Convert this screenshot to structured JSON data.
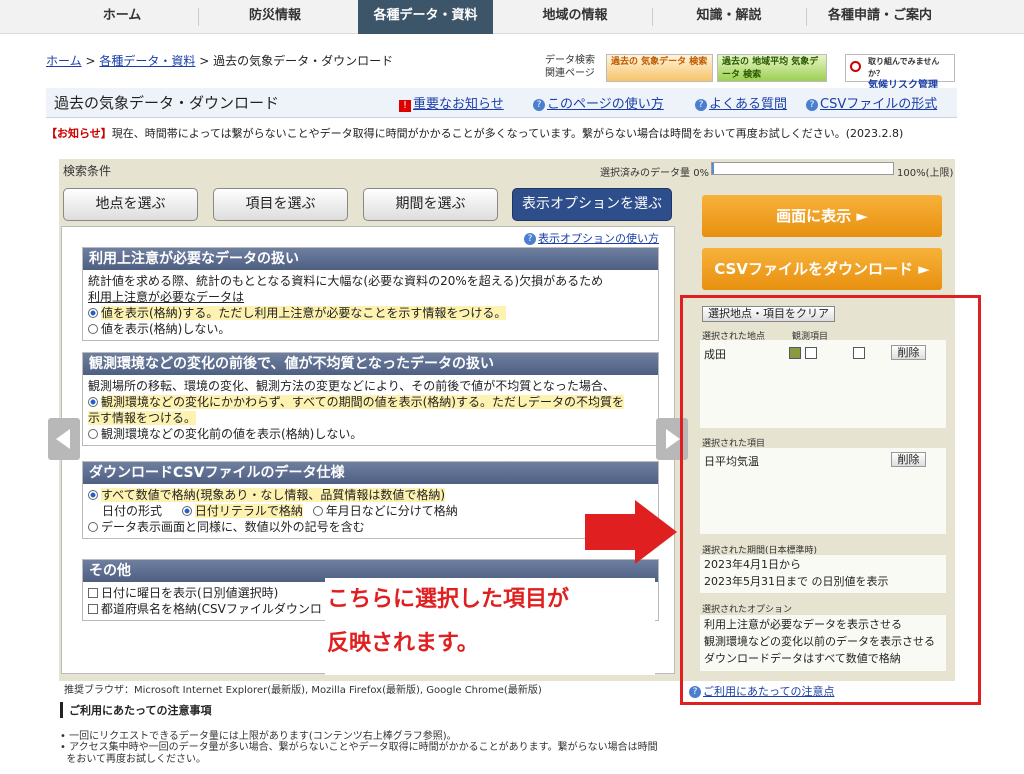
{
  "nav": {
    "items": [
      {
        "label": "ホーム"
      },
      {
        "label": "防災情報"
      },
      {
        "label": "各種データ・資料"
      },
      {
        "label": "地域の情報"
      },
      {
        "label": "知識・解説"
      },
      {
        "label": "各種申請・ご案内"
      }
    ]
  },
  "breadcrumb": {
    "home": "ホーム",
    "data": "各種データ・資料",
    "current": "過去の気象データ・ダウンロード",
    "sep": ">"
  },
  "related": {
    "line1": "データ検索",
    "line2": "関連ページ"
  },
  "banners": {
    "b1_line": "過去の 気象データ 検索",
    "b2_line": "過去の 地域平均 気象データ 検索",
    "b3_line1": "取り組んでみませんか？",
    "b3_line2": "気候リスク管理"
  },
  "title": {
    "text": "過去の気象データ・ダウンロード",
    "important": "重要なお知らせ",
    "howto": "このページの使い方",
    "faq": "よくある質問",
    "csvformat": "CSVファイルの形式"
  },
  "notice": {
    "tag": "【お知らせ】",
    "text": "現在、時間帯によっては繋がらないことやデータ取得に時間がかかることが多くなっています。繋がらない場合は時間をおいて再度お試しください。(2023.2.8)"
  },
  "search": {
    "heading": "検索条件",
    "qty_label": "選択済みのデータ量",
    "qty_min": "0%",
    "qty_max": "100%(上限)",
    "qty_fraction": 0.01,
    "tabs": [
      "地点を選ぶ",
      "項目を選ぶ",
      "期間を選ぶ",
      "表示オプションを選ぶ"
    ],
    "options_help": "表示オプションの使い方"
  },
  "sections": [
    {
      "title": "利用上注意が必要なデータの扱い",
      "desc1": "統計値を求める際、統計のもととなる資料に大幅な(必要な資料の20%を超える)欠損があるため",
      "desc2": "利用上注意が必要なデータは",
      "opt1": "値を表示(格納)する。ただし利用上注意が必要なことを示す情報をつける。",
      "opt2": "値を表示(格納)しない。"
    },
    {
      "title": "観測環境などの変化の前後で、値が不均質となったデータの扱い",
      "desc1": "観測場所の移転、環境の変化、観測方法の変更などにより、その前後で値が不均質となった場合、",
      "opt1a": "観測環境などの変化にかかわらず、すべての期間の値を表示(格納)する。ただしデータの不均質を",
      "opt1b": "示す情報をつける。",
      "opt2": "観測環境などの変化前の値を表示(格納)しない。"
    },
    {
      "title": "ダウンロードCSVファイルのデータ仕様",
      "opt1": "すべて数値で格納(現象あり・なし情報、品質情報は数値で格納)",
      "date_label": "日付の形式",
      "date_opt1": "日付リテラルで格納",
      "date_opt2": "年月日などに分けて格納",
      "opt2": "データ表示画面と同様に、数値以外の記号を含む"
    },
    {
      "title": "その他",
      "chk1": "日付に曜日を表示(日別値選択時)",
      "chk2": "都道府県名を格納(CSVファイルダウンロ"
    }
  ],
  "actions": {
    "show": "画面に表示 ►",
    "download": "CSVファイルをダウンロード ►"
  },
  "selected": {
    "clear": "選択地点・項目をクリア",
    "station_hdr": "選択された地点",
    "element_hdr": "観測項目",
    "station": "成田",
    "delete": "削除",
    "items_hdr": "選択された項目",
    "item": "日平均気温",
    "period_hdr": "選択された期間(日本標準時)",
    "period1": "2023年4月1日から",
    "period2": "2023年5月31日まで の日別値を表示",
    "option_hdr": "選択されたオプション",
    "opt1": "利用上注意が必要なデータを表示させる",
    "opt2": "観測環境などの変化以前のデータを表示させる",
    "opt3": "ダウンロードデータはすべて数値で格納",
    "notes_link": "ご利用にあたっての注意点"
  },
  "callout": {
    "line1": "こちらに選択した項目が",
    "line2": "反映されます。"
  },
  "footer": {
    "browsers": "推奨ブラウザ：Microsoft Internet Explorer(最新版), Mozilla Firefox(最新版), Google Chrome(最新版)",
    "notes_title": "ご利用にあたっての注意事項",
    "n1": "一回にリクエストできるデータ量には上限があります(コンテンツ右上棒グラフ参照)。",
    "n2a": "アクセス集中時や一回のデータ量が多い場合、繋がらないことやデータ取得に時間がかかることがあります。繋がらない場合は時間",
    "n2b": "をおいて再度お試しください。"
  },
  "colors": {
    "accent": "#3d5568",
    "orange": "#f0a020",
    "red": "#e02020",
    "section_head": "#5a6b8c"
  }
}
